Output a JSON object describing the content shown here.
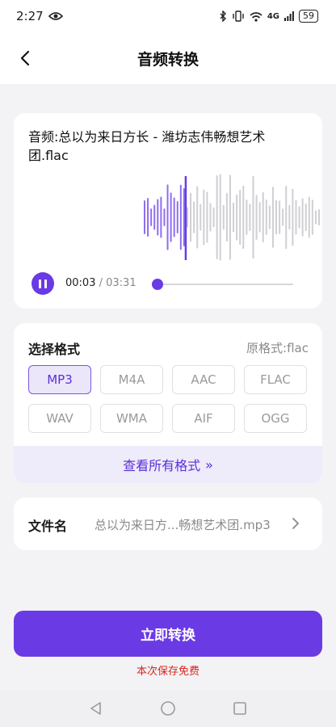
{
  "status_bar": {
    "time": "2:27",
    "signal_text": "4G",
    "battery": "59"
  },
  "header": {
    "title": "音频转换"
  },
  "player": {
    "audio_title": "音频:总以为来日方长 - 潍坊志伟畅想艺术团.flac",
    "current_time": "00:03",
    "separator": " / ",
    "total_time": "03:31",
    "progress": 0.014,
    "playhead_fraction": 0.22,
    "accent": "#6a3be4"
  },
  "format": {
    "heading": "选择格式",
    "original": "原格式:flac",
    "options": [
      "MP3",
      "M4A",
      "AAC",
      "FLAC",
      "WAV",
      "WMA",
      "AIF",
      "OGG"
    ],
    "selected": "MP3",
    "view_all": "查看所有格式",
    "view_all_arrow": "»"
  },
  "file": {
    "label": "文件名",
    "value": "总以为来日方...畅想艺术团.mp3"
  },
  "actions": {
    "convert": "立即转换",
    "save_note": "本次保存免费"
  }
}
